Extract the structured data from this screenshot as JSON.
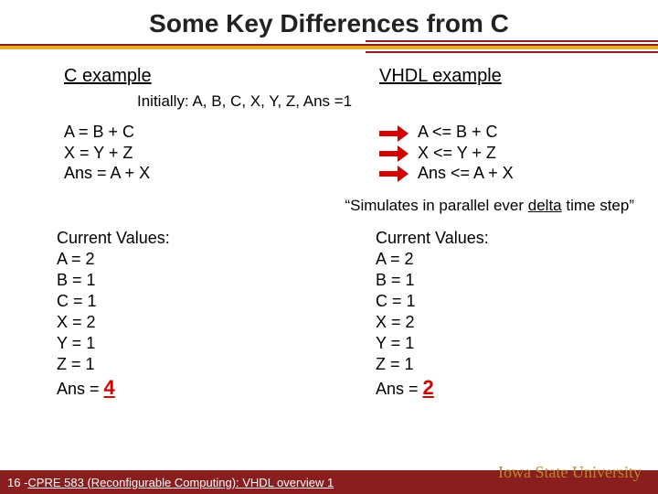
{
  "title": "Some Key Differences from C",
  "left_heading": "C example",
  "right_heading": "VHDL example",
  "initial": "Initially: A, B, C, X, Y, Z, Ans =1",
  "c_code": "A = B + C\nX = Y + Z\nAns = A + X",
  "vhdl_code": "A <= B + C\nX <= Y + Z\nAns <= A + X",
  "sim_note_prefix": "“Simulates in parallel ever ",
  "sim_note_delta": "delta",
  "sim_note_suffix": " time step”",
  "left_vals_head": "Current Values:",
  "left_vals_lines": "A = 2\nB = 1\nC = 1\nX = 2\nY = 1\nZ = 1",
  "left_ans_label": "Ans = ",
  "left_ans_value": "4",
  "right_vals_head": "Current Values:",
  "right_vals_lines": "A = 2\nB = 1\nC = 1\nX = 2\nY = 1\nZ = 1",
  "right_ans_label": "Ans = ",
  "right_ans_value": "2",
  "footer_page": "16 - ",
  "footer_course": "CPRE 583 (Reconfigurable Computing):  VHDL overview 1",
  "footer_uni": "Iowa State University"
}
